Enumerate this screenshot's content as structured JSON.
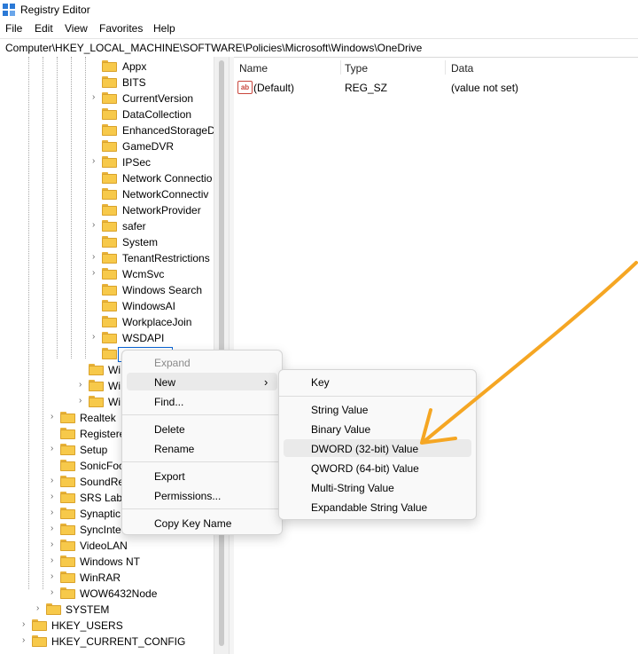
{
  "window": {
    "title": "Registry Editor"
  },
  "menu": [
    "File",
    "Edit",
    "View",
    "Favorites",
    "Help"
  ],
  "address": "Computer\\HKEY_LOCAL_MACHINE\\SOFTWARE\\Policies\\Microsoft\\Windows\\OneDrive",
  "tree": {
    "windows_children": [
      "Appx",
      "BITS",
      "CurrentVersion",
      "DataCollection",
      "EnhancedStorageD",
      "GameDVR",
      "IPSec",
      "Network Connectio",
      "NetworkConnectiv",
      "NetworkProvider",
      "safer",
      "System",
      "TenantRestrictions",
      "WcmSvc",
      "Windows Search",
      "WindowsAI",
      "WorkplaceJoin",
      "WSDAPI"
    ],
    "ms_children_partial": [
      "Wi",
      "Wi",
      "Wi"
    ],
    "policies_siblings": [
      "Realtek",
      "Registere",
      "Setup",
      "SonicFoc",
      "SoundRe",
      "SRS Labs",
      "Synaptic",
      "SyncInte",
      "VideoLAN",
      "Windows NT",
      "WinRAR",
      "WOW6432Node"
    ],
    "system": "SYSTEM",
    "hives": [
      "HKEY_USERS",
      "HKEY_CURRENT_CONFIG"
    ]
  },
  "list": {
    "columns": [
      "Name",
      "Type",
      "Data"
    ],
    "rows": [
      {
        "name": "(Default)",
        "type": "REG_SZ",
        "data": "(value not set)",
        "icon": "string-value-icon"
      }
    ]
  },
  "context_menu": {
    "expand": "Expand",
    "new": "New",
    "find": "Find...",
    "delete": "Delete",
    "rename": "Rename",
    "export": "Export",
    "permissions": "Permissions...",
    "copy_key_name": "Copy Key Name"
  },
  "new_submenu": {
    "key": "Key",
    "items": [
      "String Value",
      "Binary Value",
      "DWORD (32-bit) Value",
      "QWORD (64-bit) Value",
      "Multi-String Value",
      "Expandable String Value"
    ],
    "highlighted": "DWORD (32-bit) Value"
  },
  "colors": {
    "annotation_arrow": "#f5a623",
    "selection": "#0a64d6"
  }
}
